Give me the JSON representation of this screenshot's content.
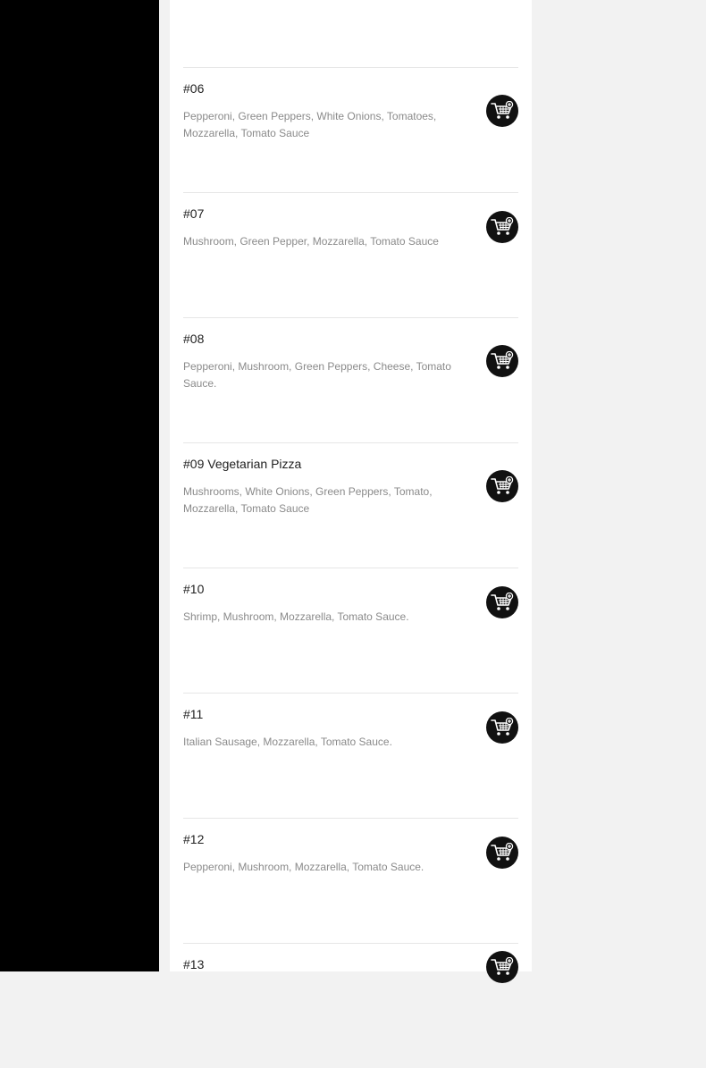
{
  "menu": {
    "items": [
      {
        "title": "#06",
        "description": "Pepperoni, Green Peppers, White Onions, Tomatoes, Mozzarella, Tomato Sauce",
        "icon": "add-to-cart-icon"
      },
      {
        "title": "#07",
        "description": "Mushroom, Green Pepper, Mozzarella, Tomato Sauce",
        "icon": "add-to-cart-icon"
      },
      {
        "title": "#08",
        "description": "Pepperoni, Mushroom, Green Peppers, Cheese, Tomato Sauce.",
        "icon": "add-to-cart-icon"
      },
      {
        "title": "#09 Vegetarian Pizza",
        "description": "Mushrooms, White Onions, Green Peppers, Tomato, Mozzarella, Tomato Sauce",
        "icon": "add-to-cart-icon"
      },
      {
        "title": "#10",
        "description": "Shrimp, Mushroom, Mozzarella, Tomato Sauce.",
        "icon": "add-to-cart-icon"
      },
      {
        "title": "#11",
        "description": "Italian Sausage, Mozzarella, Tomato Sauce.",
        "icon": "add-to-cart-icon"
      },
      {
        "title": "#12",
        "description": "Pepperoni, Mushroom, Mozzarella, Tomato Sauce.",
        "icon": "add-to-cart-icon"
      },
      {
        "title": "#13",
        "description": "",
        "icon": "add-to-cart-icon"
      }
    ]
  },
  "colors": {
    "sidebar": "#000000",
    "panel": "#ffffff",
    "background": "#f2f2f2",
    "cart_button": "#111111"
  }
}
